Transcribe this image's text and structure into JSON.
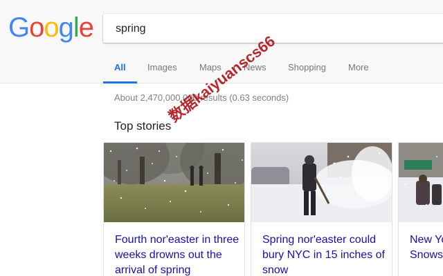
{
  "logo": {
    "letters": [
      "G",
      "o",
      "o",
      "g",
      "l",
      "e"
    ],
    "colors": [
      "#4285f4",
      "#ea4335",
      "#fbbc05",
      "#4285f4",
      "#34a853",
      "#ea4335"
    ]
  },
  "search": {
    "value": "spring"
  },
  "tabs": [
    {
      "label": "All",
      "active": true
    },
    {
      "label": "Images",
      "active": false
    },
    {
      "label": "Maps",
      "active": false
    },
    {
      "label": "News",
      "active": false
    },
    {
      "label": "Shopping",
      "active": false
    },
    {
      "label": "More",
      "active": false
    }
  ],
  "results": {
    "stats": "About 2,470,000,000 results (0.63 seconds)",
    "top_stories_title": "Top stories",
    "stories": [
      {
        "title": "Fourth nor'easter in three weeks drowns out the arrival of spring",
        "image": "snowy-park-photo"
      },
      {
        "title": "Spring nor'easter could bury NYC in 15 inches of snow",
        "image": "snow-shoveling-photo"
      },
      {
        "title": "New York Update Snowstorm",
        "image": "snowy-street-photo"
      }
    ]
  },
  "watermark": {
    "text": "数据kaiyuanscs66",
    "color": "#b0161c"
  },
  "theme": {
    "accent": "#1a73e8",
    "link": "#1a0dab",
    "header_bg": "#f8f8f8"
  }
}
